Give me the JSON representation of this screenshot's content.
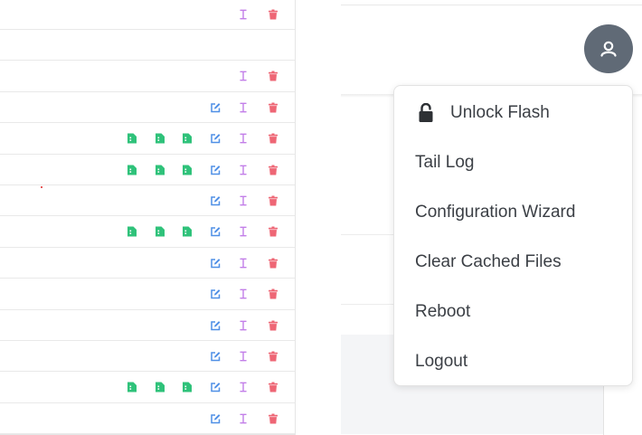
{
  "menu": {
    "items": [
      {
        "label": "Unlock Flash",
        "icon": "lock-icon"
      },
      {
        "label": "Tail Log"
      },
      {
        "label": "Configuration Wizard"
      },
      {
        "label": "Clear Cached Files"
      },
      {
        "label": "Reboot"
      },
      {
        "label": "Logout"
      }
    ]
  },
  "user_menu": {
    "icon": "user-icon",
    "color": "#606a76"
  },
  "table": {
    "action_colors": {
      "file": "#2fc27a",
      "edit": "#4f8fe6",
      "cursor": "#c27ee8",
      "delete": "#ee6675"
    },
    "rows": [
      {
        "actions": [
          "cursor",
          "delete"
        ]
      },
      {
        "actions": []
      },
      {
        "actions": [
          "cursor",
          "delete"
        ]
      },
      {
        "actions": [
          "edit",
          "cursor",
          "delete"
        ]
      },
      {
        "actions": [
          "file",
          "file",
          "file",
          "edit",
          "cursor",
          "delete"
        ]
      },
      {
        "actions": [
          "file",
          "file",
          "file",
          "edit",
          "cursor",
          "delete"
        ]
      },
      {
        "actions": [
          "edit",
          "cursor",
          "delete"
        ]
      },
      {
        "actions": [
          "file",
          "file",
          "file",
          "edit",
          "cursor",
          "delete"
        ]
      },
      {
        "actions": [
          "edit",
          "cursor",
          "delete"
        ]
      },
      {
        "actions": [
          "edit",
          "cursor",
          "delete"
        ]
      },
      {
        "actions": [
          "edit",
          "cursor",
          "delete"
        ]
      },
      {
        "actions": [
          "edit",
          "cursor",
          "delete"
        ]
      },
      {
        "actions": [
          "file",
          "file",
          "file",
          "edit",
          "cursor",
          "delete"
        ]
      },
      {
        "actions": [
          "edit",
          "cursor",
          "delete"
        ]
      }
    ]
  }
}
